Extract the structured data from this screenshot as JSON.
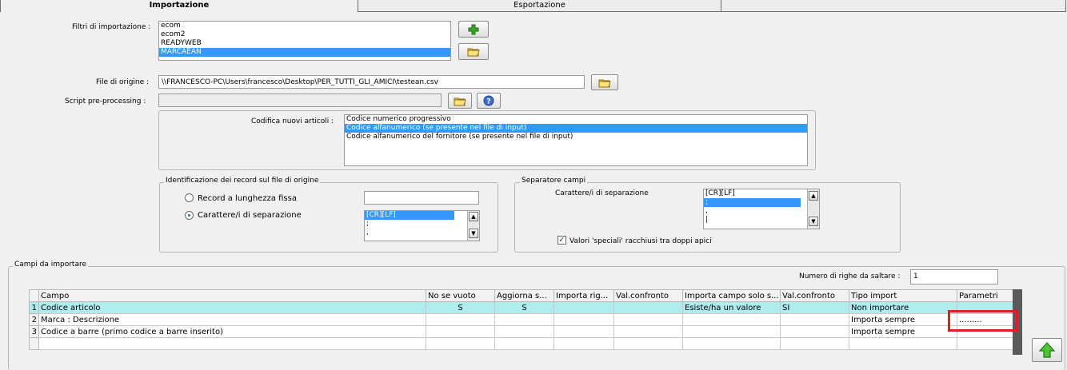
{
  "tabs": [
    {
      "label": "Importazione"
    },
    {
      "label": "Esportazione"
    }
  ],
  "filters": {
    "label": "Filtri di importazione :",
    "items": [
      "ecom",
      "ecom2",
      "READYWEB",
      "MARCAEAN"
    ],
    "selected": "MARCAEAN"
  },
  "source_file": {
    "label": "File di origine :",
    "value": "\\\\FRANCESCO-PC\\Users\\francesco\\Desktop\\PER_TUTTI_GLI_AMICI\\testean.csv"
  },
  "script": {
    "label": "Script pre-processing :",
    "value": ""
  },
  "coding": {
    "label": "Codifica nuovi articoli :",
    "options": [
      "Codice numerico progressivo",
      "Codice alfanumerico (se presente nel file di input)",
      "Codice alfanumerico del fornitore (se presente nel file di input)"
    ],
    "selected": "Codice alfanumerico (se presente nel file di input)"
  },
  "record_id": {
    "title": "Identificazione dei record sul file di origine",
    "fixed_label": "Record a lunghezza fissa",
    "sep_label": "Carattere/i di separazione",
    "selected": "Carattere/i di separazione",
    "fixed_value": "",
    "sep_items": [
      "[CR][LF]",
      ";",
      ","
    ],
    "sep_selected": "[CR][LF]"
  },
  "field_sep": {
    "title": "Separatore campi",
    "label": "Carattere/i di separazione",
    "items": [
      "[CR][LF]",
      ";",
      ",",
      "|"
    ],
    "selected": ";",
    "quotes_label": "Valori 'speciali' racchiusi tra doppi apici",
    "quotes_checked": true
  },
  "fields": {
    "title": "Campi da importare",
    "skip_label": "Numero di righe da saltare :",
    "skip_value": "1",
    "columns": [
      "Campo",
      "No se vuoto",
      "Aggiorna s...",
      "Importa rig...",
      "Val.confronto",
      "Importa campo solo s...",
      "Val.confronto",
      "Tipo import",
      "Parametri"
    ],
    "rows": [
      {
        "n": "1",
        "cells": [
          "Codice articolo",
          "S",
          "S",
          "",
          "",
          "Esiste/ha un valore",
          "SI",
          "Non importare",
          ""
        ]
      },
      {
        "n": "2",
        "cells": [
          "Marca : Descrizione",
          "",
          "",
          "",
          "",
          "",
          "",
          "Importa sempre",
          "........."
        ]
      },
      {
        "n": "3",
        "cells": [
          "Codice a barre (primo codice a barre inserito)",
          "",
          "",
          "",
          "",
          "",
          "",
          "Importa sempre",
          ""
        ]
      }
    ]
  },
  "icons": {
    "add": "plus-icon",
    "folder": "folder-icon",
    "help": "help-icon",
    "up": "arrow-up-icon"
  },
  "colors": {
    "selection": "#3399ff",
    "row_highlight": "#aeeced",
    "annotation_box": "#e02020",
    "grid_scrollbar": "#5a5a5a"
  }
}
